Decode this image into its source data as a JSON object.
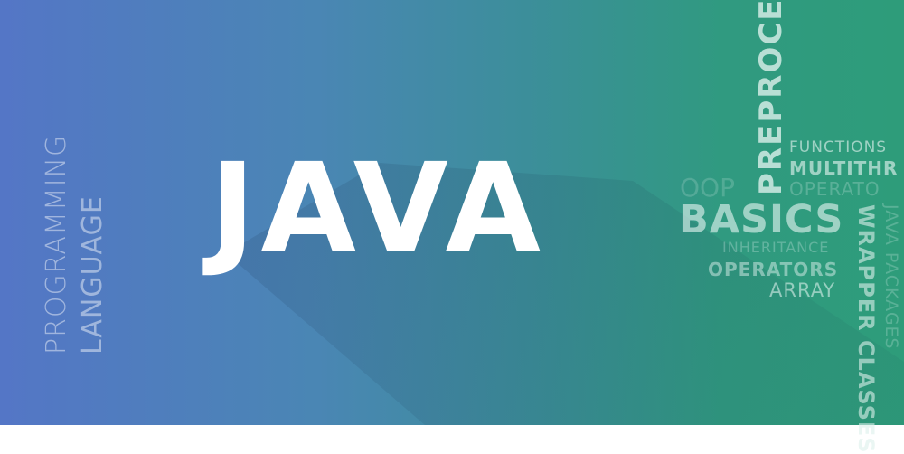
{
  "title": "JAVA",
  "left_words": [
    "PROGRAMMING",
    "LANGUAGE"
  ],
  "cloud": {
    "preprocessor": "PREPROCE",
    "functions": "FUNCTIONS",
    "multithreading": "MULTITHR",
    "oop": "OOP",
    "operators_light": "OPERATO",
    "basics": "BASICS",
    "inheritance": "INHERITANCE",
    "operators": "OPERATORS",
    "array": "ARRAY",
    "wrapper_classes": "WRAPPER CLASSES",
    "java_packages": "JAVA PACKAGES"
  },
  "colors": {
    "left": "#5476c6",
    "right": "#2e9c7a"
  }
}
